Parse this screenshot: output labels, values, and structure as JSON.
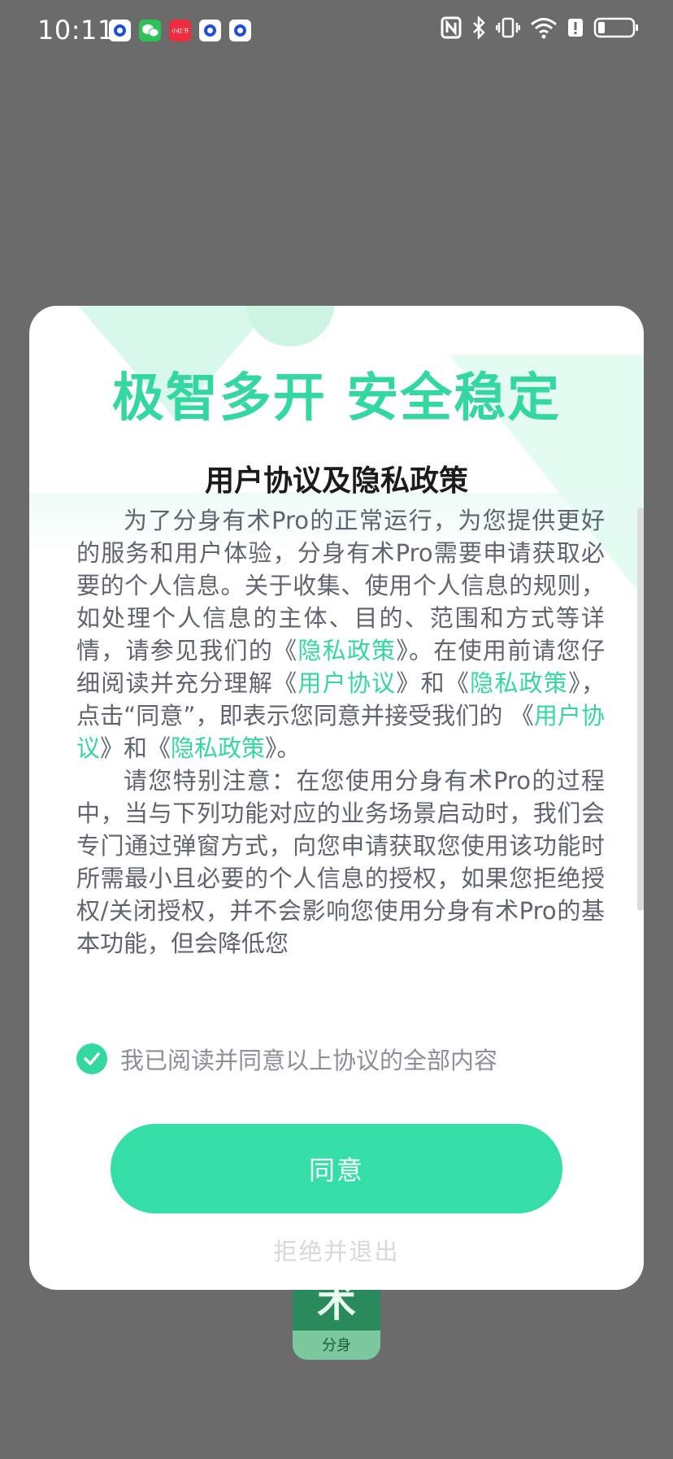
{
  "status_bar": {
    "time": "10:11",
    "notification_icons": [
      "blue-circle-icon",
      "wechat-icon",
      "xiaohongshu-icon",
      "blue-circle-icon",
      "blue-circle-icon"
    ],
    "xhs_label": "小红书",
    "system_icons": [
      "nfc-icon",
      "bluetooth-icon",
      "vibrate-icon",
      "wifi-icon",
      "battery-alert-icon",
      "battery-icon"
    ]
  },
  "app_icon": {
    "glyph": "术",
    "label": "分身"
  },
  "dialog": {
    "slogan": "极智多开 安全稳定",
    "title": "用户协议及隐私政策",
    "para1": {
      "t1": "为了分身有术Pro的正常运行，为您提供更好的服务和用户体验，分身有术Pro需要申请获取必要的个人信息。关于收集、使用个人信息的规则，如处理个人信息的主体、目的、范围和方式等详情，请参见我们的《",
      "l1": "隐私政策",
      "t2": "》。在使用前请您仔细阅读并充分理解《",
      "l2": "用户协议",
      "t3": "》和《",
      "l3": "隐私政策",
      "t4": "》，点击“同意”，即表示您同意并接受我们的 《",
      "l4": "用户协议",
      "t5": "》和《",
      "l5": "隐私政策",
      "t6": "》。"
    },
    "para2": "请您特别注意：在您使用分身有术Pro的过程中，当与下列功能对应的业务场景启动时，我们会专门通过弹窗方式，向您申请获取您使用该功能时所需最小且必要的个人信息的授权，如果您拒绝授权/关闭授权，并不会影响您使用分身有术Pro的基本功能，但会降低您",
    "agree_checkbox_label": "我已阅读并同意以上协议的全部内容",
    "agree_checked": true,
    "agree_button": "同意",
    "reject_link": "拒绝并退出"
  },
  "colors": {
    "accent": "#35d7a0",
    "body_text": "#5e6470",
    "backdrop": "#6b6b6b"
  }
}
